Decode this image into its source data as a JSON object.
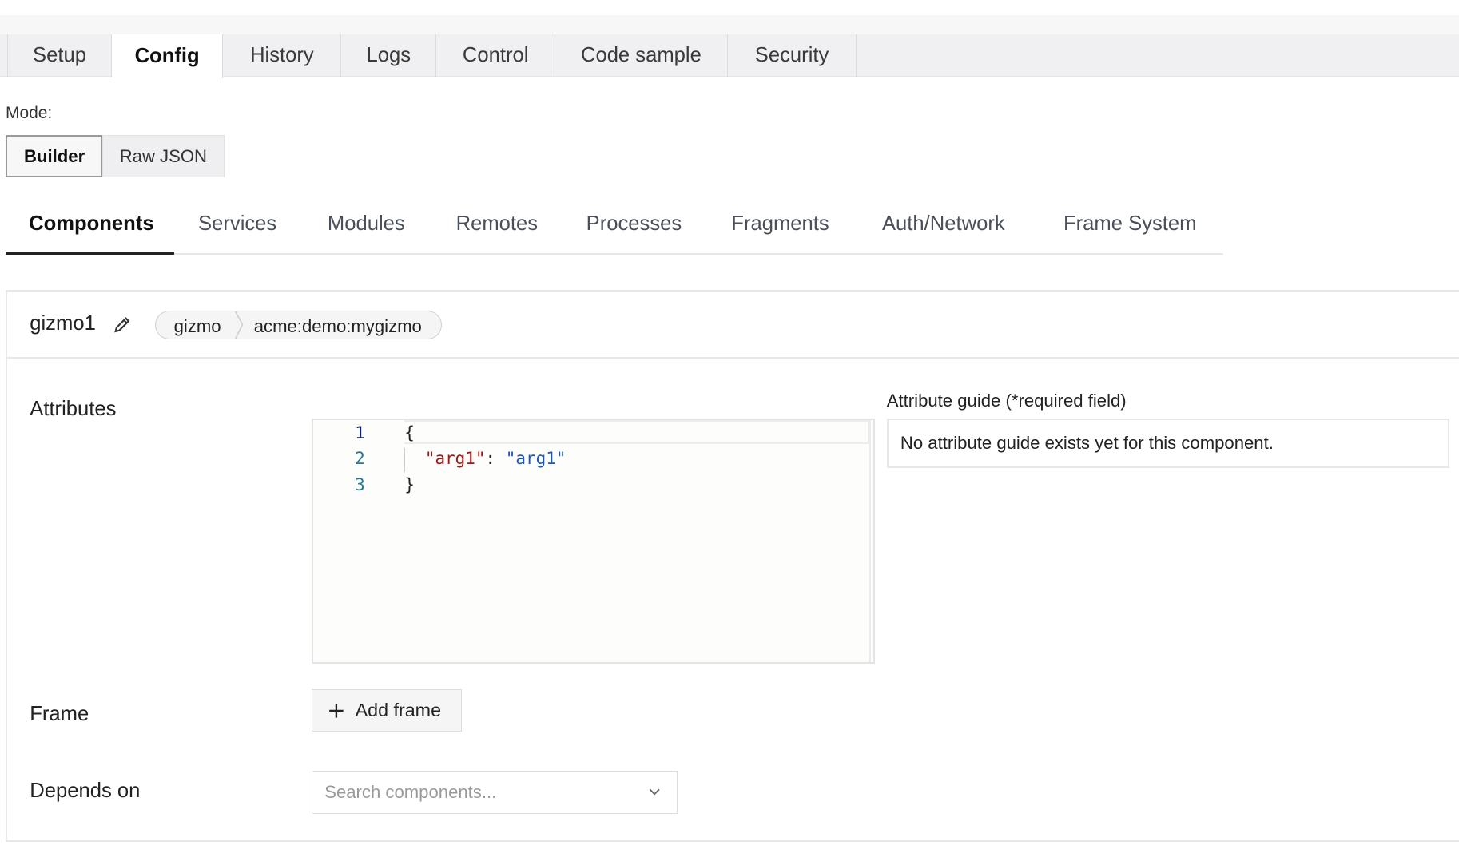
{
  "tabs": [
    {
      "label": "Setup"
    },
    {
      "label": "Config",
      "active": true
    },
    {
      "label": "History"
    },
    {
      "label": "Logs"
    },
    {
      "label": "Control"
    },
    {
      "label": "Code sample"
    },
    {
      "label": "Security"
    }
  ],
  "mode": {
    "label": "Mode:",
    "options": [
      "Builder",
      "Raw JSON"
    ],
    "selected": "Builder"
  },
  "subtabs": [
    {
      "label": "Components",
      "active": true
    },
    {
      "label": "Services"
    },
    {
      "label": "Modules"
    },
    {
      "label": "Remotes"
    },
    {
      "label": "Processes"
    },
    {
      "label": "Fragments"
    },
    {
      "label": "Auth/Network"
    },
    {
      "label": "Frame System"
    }
  ],
  "component": {
    "name": "gizmo1",
    "api": "gizmo",
    "model": "acme:demo:mygizmo",
    "attributes_label": "Attributes",
    "editor": {
      "line_numbers": [
        "1",
        "2",
        "3"
      ],
      "open_brace": "{",
      "key": "\"arg1\"",
      "colon": ": ",
      "value": "\"arg1\"",
      "close_brace": "}"
    },
    "guide_label": "Attribute guide (*required field)",
    "guide_text": "No attribute guide exists yet for this component.",
    "frame_label": "Frame",
    "add_frame": "Add frame",
    "depends_label": "Depends on",
    "depends_placeholder": "Search components..."
  },
  "colors": {
    "json_key": "#a31515",
    "json_value": "#1a55c0",
    "line_number": "#237893"
  }
}
